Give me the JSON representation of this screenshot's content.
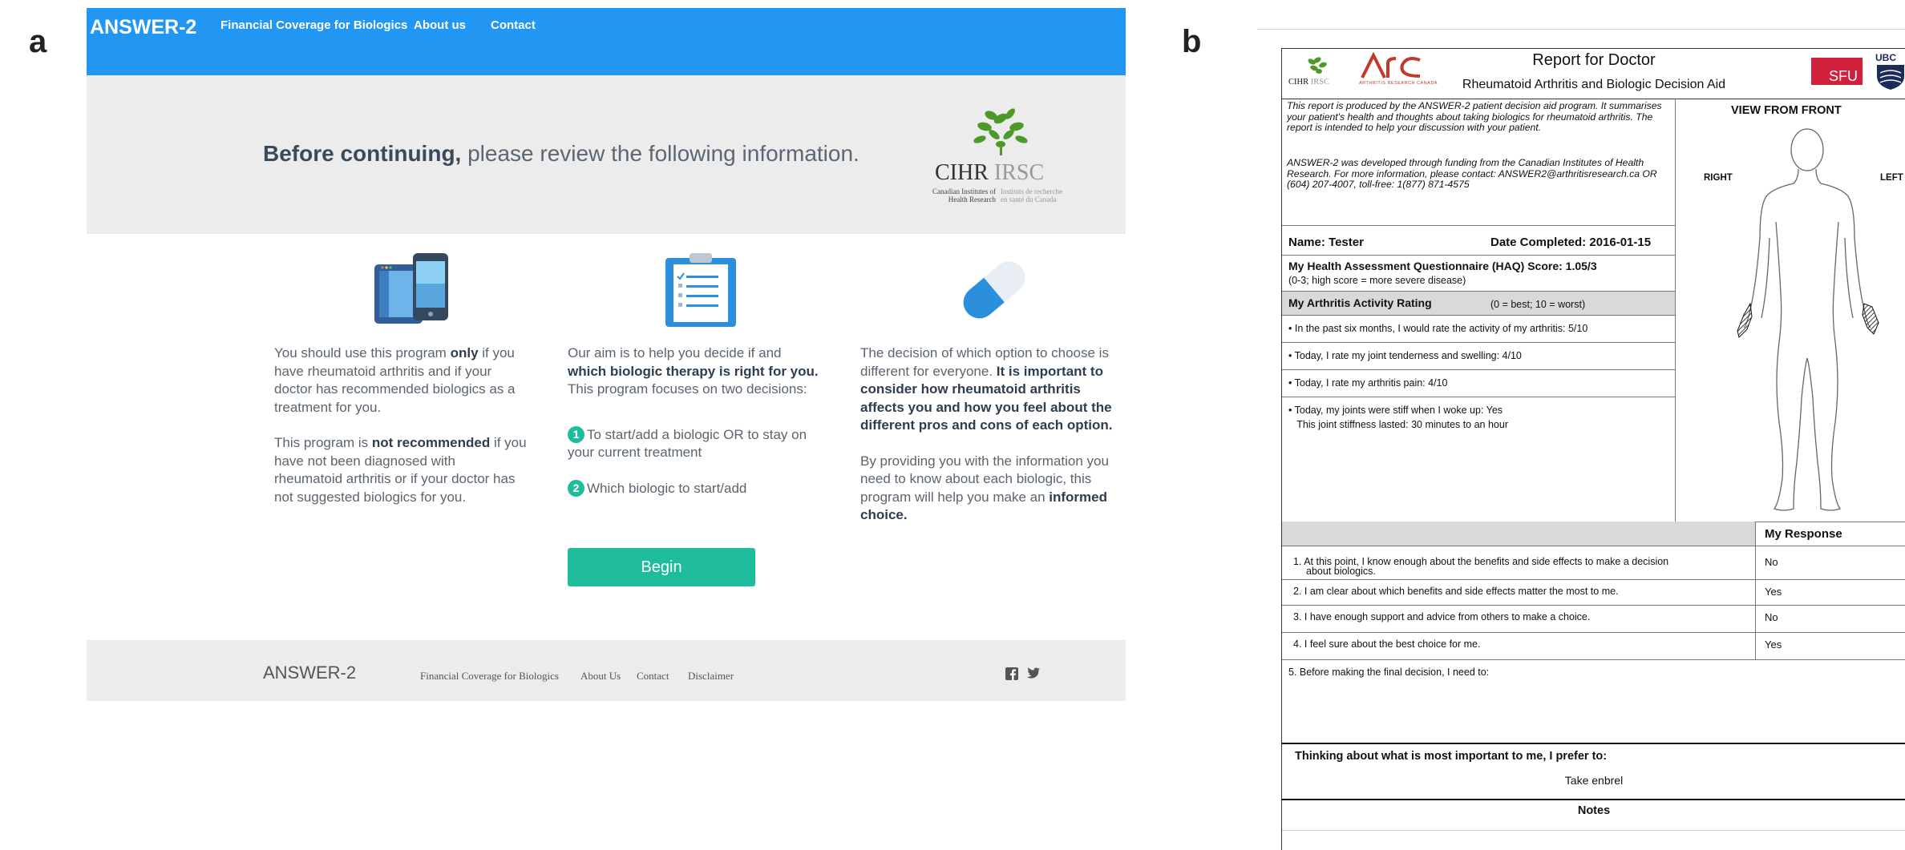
{
  "panel_labels": {
    "a": "a",
    "b": "b"
  },
  "answer_site": {
    "nav": {
      "brand": "ANSWER-2",
      "links": [
        "Financial Coverage for Biologics",
        "About us",
        "Contact"
      ]
    },
    "hero": {
      "bold": "Before continuing,",
      "rest": " please review the following information.",
      "logo": {
        "cihr": "CIHR",
        "irsc": "IRSC",
        "en_line1": "Canadian Institutes of",
        "en_line2": "Health Research",
        "fr_line1": "Instituts de recherche",
        "fr_line2": "en santé du Canada"
      }
    },
    "columns": {
      "col1": {
        "icon": "devices-icon",
        "p1_a": "You should use this program ",
        "p1_b": "only",
        "p1_c": " if you have rheumatoid arthritis and if your doctor has recommended biologics as a treatment for you.",
        "p2_a": "This program is ",
        "p2_b": "not recommended",
        "p2_c": " if you have not been diagnosed with rheumatoid arthritis or if your doctor has not suggested biologics for you."
      },
      "col2": {
        "icon": "clipboard-icon",
        "p1_a": "Our aim is to help you decide if and ",
        "p1_b": "which biologic therapy is right for you.",
        "p1_c": " This program focuses on two decisions:",
        "step1_num": "1",
        "step1": "To start/add a biologic OR to stay on your current treatment",
        "step2_num": "2",
        "step2": "Which biologic to start/add",
        "begin": "Begin"
      },
      "col3": {
        "icon": "pill-icon",
        "p1_a": "The decision of which option to choose is different for everyone. ",
        "p1_b": "It is important to consider how rheumatoid arthritis affects you and how you feel about the different pros and cons of each option.",
        "p2_a": "By providing you with the information you need to know about each biologic, this program will help you make an ",
        "p2_b": "informed choice."
      }
    },
    "footer": {
      "brand": "ANSWER-2",
      "links": [
        "Financial Coverage for Biologics",
        "About Us",
        "Contact",
        "Disclaimer"
      ],
      "social": [
        "facebook-icon",
        "twitter-icon"
      ]
    }
  },
  "report": {
    "title": "Report for Doctor",
    "subtitle": "Rheumatoid Arthritis and Biologic Decision Aid",
    "logos": {
      "cihr": "CIHR",
      "irsc": "IRSC",
      "arc": "ARC",
      "arc_sub": "ARTHRITIS RESEARCH CANADA",
      "sfu": "SFU",
      "ubc": "UBC"
    },
    "intro1": "This report is produced by the ANSWER-2 patient decision aid program. It summarises your patient's health and thoughts about taking biologics for rheumatoid arthritis. The report is intended to help your discussion with your patient.",
    "intro2": "ANSWER-2 was developed through funding from the Canadian Institutes of Health Research. For more information, please contact: ANSWER2@arthritisresearch.ca  OR (604) 207-4007, toll-free: 1(877) 871-4575",
    "name": "Name:  Tester",
    "date": "Date Completed:  2016-01-15",
    "haq": "My Health Assessment Questionnaire (HAQ) Score:  1.05/3",
    "haq_note": "(0-3; high score = more severe disease)",
    "rating_title": "My Arthritis Activity Rating",
    "rating_scale": "(0 = best; 10 = worst)",
    "ratings": [
      "•  In the past six months, I would rate the activity of my arthritis: 5/10",
      "• Today, I rate my joint tenderness and swelling: 4/10",
      "• Today, I rate my arthritis pain: 4/10",
      "• Today, my joints were stiff when I woke up: Yes",
      "   This joint stiffness lasted: 30 minutes to an hour"
    ],
    "view_title": "VIEW FROM FRONT",
    "right": "RIGHT",
    "left": "LEFT",
    "response_header": "My Response",
    "questions": [
      {
        "q": "1.  At this point, I know enough about the benefits and side effects to make a decision",
        "q2": "about biologics.",
        "a": "No"
      },
      {
        "q": "2.  I am clear about which benefits and side effects matter the most to me.",
        "a": "Yes"
      },
      {
        "q": "3.  I have enough support and advice from others to make a choice.",
        "a": "No"
      },
      {
        "q": "4.  I feel sure about the best choice for me.",
        "a": "Yes"
      }
    ],
    "q5": "5. Before making the final decision, I need to:",
    "prefer_title": "Thinking about what is most important to me, I prefer to:",
    "prefer_answer": "Take enbrel",
    "notes": "Notes"
  }
}
